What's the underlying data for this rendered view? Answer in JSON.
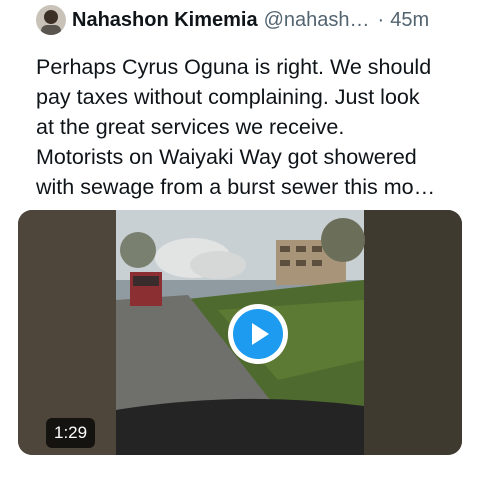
{
  "tweet": {
    "author_name": "Nahashon Kimemia",
    "handle": "@nahash…",
    "separator": "·",
    "time": "45m",
    "text_lines": [
      "Perhaps Cyrus Oguna is right. We should",
      "pay taxes without complaining. Just look",
      "at the great services we receive.",
      "Motorists on Waiyaki Way got showered",
      "with sewage from a burst sewer this mo…"
    ],
    "video": {
      "duration": "1:29",
      "play_icon": "play-icon"
    }
  },
  "colors": {
    "accent": "#1d9bf0",
    "text": "#0f1419",
    "secondary_text": "#536471"
  }
}
